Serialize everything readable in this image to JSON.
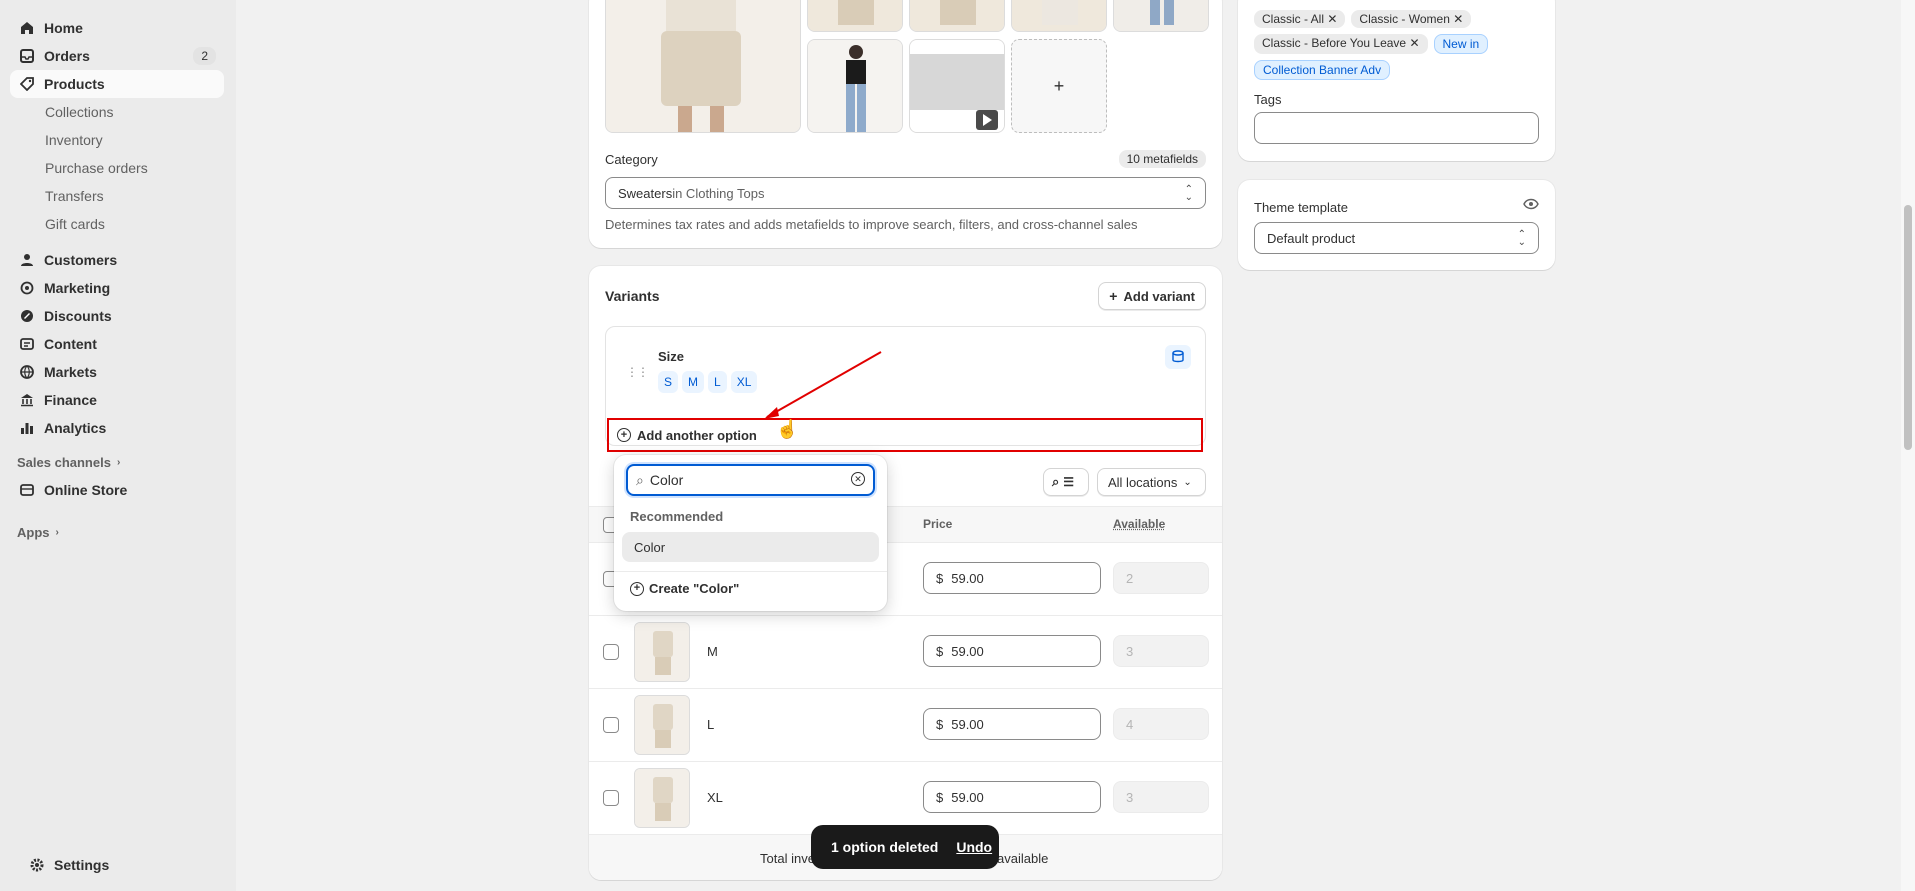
{
  "sidebar": {
    "items": [
      {
        "label": "Home",
        "icon": "home-icon"
      },
      {
        "label": "Orders",
        "icon": "inbox-icon",
        "badge": "2"
      },
      {
        "label": "Products",
        "icon": "tag-icon"
      }
    ],
    "product_subitems": [
      "Collections",
      "Inventory",
      "Purchase orders",
      "Transfers",
      "Gift cards"
    ],
    "items2": [
      {
        "label": "Customers",
        "icon": "person-icon"
      },
      {
        "label": "Marketing",
        "icon": "target-icon"
      },
      {
        "label": "Discounts",
        "icon": "discount-icon"
      },
      {
        "label": "Content",
        "icon": "content-icon"
      },
      {
        "label": "Markets",
        "icon": "globe-icon"
      },
      {
        "label": "Finance",
        "icon": "bank-icon"
      },
      {
        "label": "Analytics",
        "icon": "bar-chart-icon"
      }
    ],
    "sales_channels_label": "Sales channels",
    "online_store_label": "Online Store",
    "apps_label": "Apps",
    "settings_label": "Settings"
  },
  "media": {
    "add_symbol": "+"
  },
  "category": {
    "label": "Category",
    "metafields_badge": "10 metafields",
    "value_main": "Sweaters",
    "value_rest": " in Clothing Tops",
    "help": "Determines tax rates and adds metafields to improve search, filters, and cross-channel sales"
  },
  "variants": {
    "title": "Variants",
    "add_variant_label": "Add variant",
    "option_name": "Size",
    "option_values": [
      "S",
      "M",
      "L",
      "XL"
    ],
    "add_another_option_label": "Add another option",
    "locations_label": "All locations",
    "price_header": "Price",
    "available_header": "Available",
    "rows": [
      {
        "name": "",
        "price": "59.00",
        "available": "2"
      },
      {
        "name": "M",
        "price": "59.00",
        "available": "3"
      },
      {
        "name": "L",
        "price": "59.00",
        "available": "4"
      },
      {
        "name": "XL",
        "price": "59.00",
        "available": "3"
      }
    ],
    "currency": "$",
    "total_left": "Total inve",
    "total_right": "available"
  },
  "dropdown": {
    "search_value": "Color",
    "section_label": "Recommended",
    "option": "Color",
    "create_label": "Create \"Color\""
  },
  "collections": {
    "chips": [
      "Classic - All",
      "Classic - Women",
      "Classic - Before You Leave"
    ],
    "chips_highlight": [
      "New in",
      "Collection Banner Adv"
    ],
    "tags_label": "Tags",
    "tags_value": ""
  },
  "theme": {
    "label": "Theme template",
    "value": "Default product"
  },
  "toast": {
    "message": "1 option deleted",
    "undo_label": "Undo"
  },
  "colors": {
    "highlight_red": "#e10000",
    "focus_blue": "#005bd3"
  }
}
